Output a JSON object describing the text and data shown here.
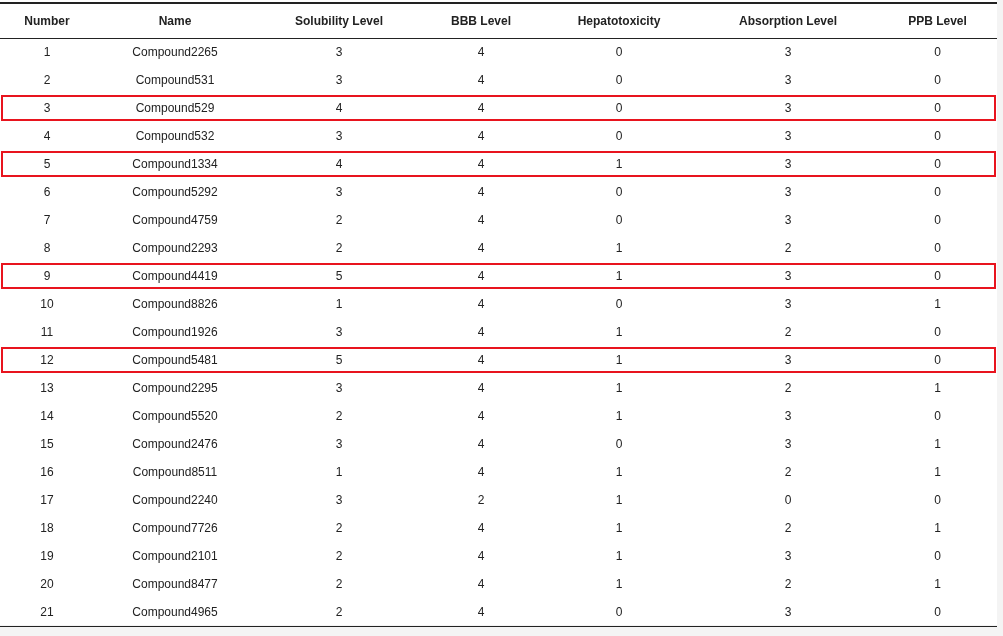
{
  "table": {
    "columns": [
      "Number",
      "Name",
      "Solubility Level",
      "BBB Level",
      "Hepatotoxicity",
      "Absorption Level",
      "PPB Level"
    ],
    "rows": [
      {
        "cells": [
          "1",
          "Compound2265",
          "3",
          "4",
          "0",
          "3",
          "0"
        ],
        "highlighted": false
      },
      {
        "cells": [
          "2",
          "Compound531",
          "3",
          "4",
          "0",
          "3",
          "0"
        ],
        "highlighted": false
      },
      {
        "cells": [
          "3",
          "Compound529",
          "4",
          "4",
          "0",
          "3",
          "0"
        ],
        "highlighted": true
      },
      {
        "cells": [
          "4",
          "Compound532",
          "3",
          "4",
          "0",
          "3",
          "0"
        ],
        "highlighted": false
      },
      {
        "cells": [
          "5",
          "Compound1334",
          "4",
          "4",
          "1",
          "3",
          "0"
        ],
        "highlighted": true
      },
      {
        "cells": [
          "6",
          "Compound5292",
          "3",
          "4",
          "0",
          "3",
          "0"
        ],
        "highlighted": false
      },
      {
        "cells": [
          "7",
          "Compound4759",
          "2",
          "4",
          "0",
          "3",
          "0"
        ],
        "highlighted": false
      },
      {
        "cells": [
          "8",
          "Compound2293",
          "2",
          "4",
          "1",
          "2",
          "0"
        ],
        "highlighted": false
      },
      {
        "cells": [
          "9",
          "Compound4419",
          "5",
          "4",
          "1",
          "3",
          "0"
        ],
        "highlighted": true
      },
      {
        "cells": [
          "10",
          "Compound8826",
          "1",
          "4",
          "0",
          "3",
          "1"
        ],
        "highlighted": false
      },
      {
        "cells": [
          "11",
          "Compound1926",
          "3",
          "4",
          "1",
          "2",
          "0"
        ],
        "highlighted": false
      },
      {
        "cells": [
          "12",
          "Compound5481",
          "5",
          "4",
          "1",
          "3",
          "0"
        ],
        "highlighted": true
      },
      {
        "cells": [
          "13",
          "Compound2295",
          "3",
          "4",
          "1",
          "2",
          "1"
        ],
        "highlighted": false
      },
      {
        "cells": [
          "14",
          "Compound5520",
          "2",
          "4",
          "1",
          "3",
          "0"
        ],
        "highlighted": false
      },
      {
        "cells": [
          "15",
          "Compound2476",
          "3",
          "4",
          "0",
          "3",
          "1"
        ],
        "highlighted": false
      },
      {
        "cells": [
          "16",
          "Compound8511",
          "1",
          "4",
          "1",
          "2",
          "1"
        ],
        "highlighted": false
      },
      {
        "cells": [
          "17",
          "Compound2240",
          "3",
          "2",
          "1",
          "0",
          "0"
        ],
        "highlighted": false
      },
      {
        "cells": [
          "18",
          "Compound7726",
          "2",
          "4",
          "1",
          "2",
          "1"
        ],
        "highlighted": false
      },
      {
        "cells": [
          "19",
          "Compound2101",
          "2",
          "4",
          "1",
          "3",
          "0"
        ],
        "highlighted": false
      },
      {
        "cells": [
          "20",
          "Compound8477",
          "2",
          "4",
          "1",
          "2",
          "1"
        ],
        "highlighted": false
      },
      {
        "cells": [
          "21",
          "Compound4965",
          "2",
          "4",
          "0",
          "3",
          "0"
        ],
        "highlighted": false
      }
    ]
  }
}
